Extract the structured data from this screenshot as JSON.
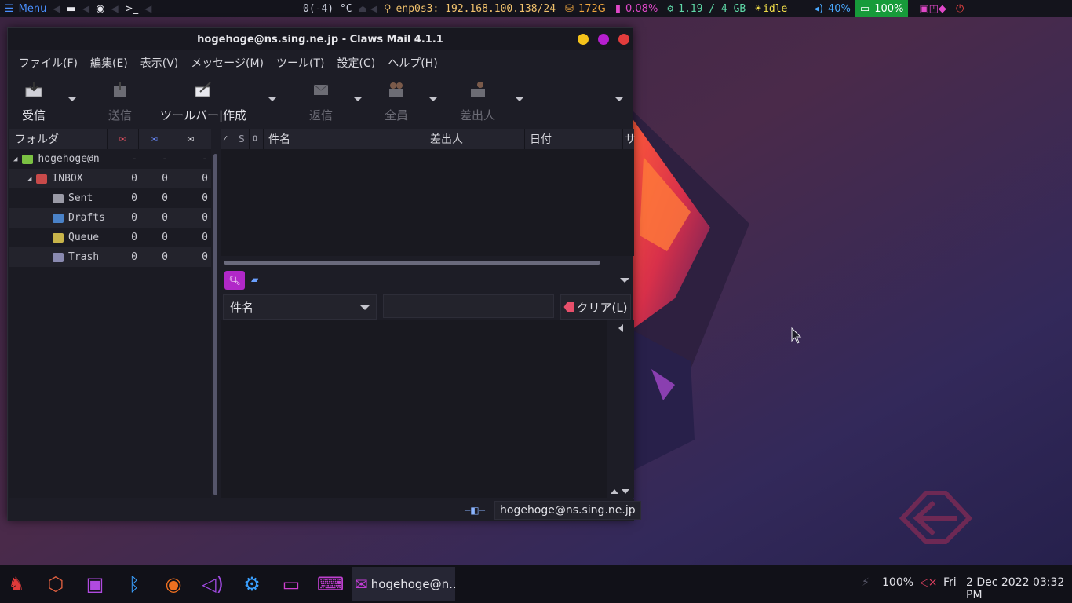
{
  "topbar": {
    "menu_label": "Menu",
    "temperature": "0(-4) °C",
    "network": "enp0s3: 192.168.100.138/24",
    "disk": "172G",
    "cpu": "0.08%",
    "memory": "1.19 / 4 GB",
    "idle": "idle",
    "volume": "40%",
    "battery": "100%"
  },
  "window": {
    "title": "hogehoge@ns.sing.ne.jp - Claws Mail 4.1.1"
  },
  "menubar": [
    "ファイル(F)",
    "編集(E)",
    "表示(V)",
    "メッセージ(M)",
    "ツール(T)",
    "設定(C)",
    "ヘルプ(H)"
  ],
  "toolbar": {
    "receive": "受信",
    "send": "送信",
    "compose": "ツールバー|作成",
    "reply": "返信",
    "reply_all": "全員",
    "reply_sender": "差出人"
  },
  "folder_pane": {
    "header": "フォルダ",
    "rows": [
      {
        "name": "hogehoge@n",
        "new": "-",
        "unread": "-",
        "total": "-"
      },
      {
        "name": "INBOX",
        "new": "0",
        "unread": "0",
        "total": "0"
      },
      {
        "name": "Sent",
        "new": "0",
        "unread": "0",
        "total": "0"
      },
      {
        "name": "Drafts",
        "new": "0",
        "unread": "0",
        "total": "0"
      },
      {
        "name": "Queue",
        "new": "0",
        "unread": "0",
        "total": "0"
      },
      {
        "name": "Trash",
        "new": "0",
        "unread": "0",
        "total": "0"
      }
    ]
  },
  "message_list": {
    "col_s": "S",
    "col_subject": "件名",
    "col_from": "差出人",
    "col_date": "日付",
    "col_size": "サ"
  },
  "quick_search": {
    "field": "件名",
    "query": "",
    "clear": "クリア(L)"
  },
  "statusbar": {
    "account": "hogehoge@ns.sing.ne.jp"
  },
  "taskbar": {
    "active_window": "hogehoge@n..",
    "brightness": "100%",
    "day": "Fri",
    "datetime": "2 Dec 2022 03:32 PM"
  }
}
